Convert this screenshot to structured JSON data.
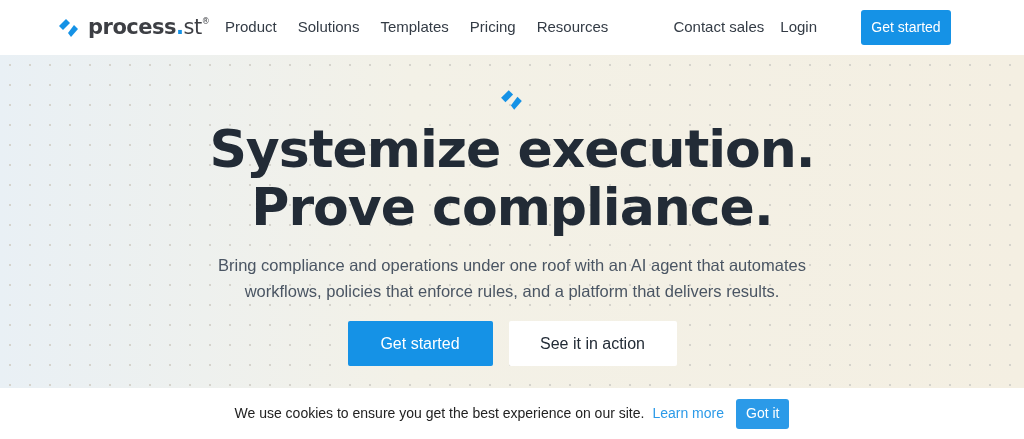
{
  "logo": {
    "name": "process",
    "dot": ".",
    "suffix": "st",
    "registered": "®"
  },
  "nav": {
    "links": [
      "Product",
      "Solutions",
      "Templates",
      "Pricing",
      "Resources"
    ],
    "right_links": [
      "Contact sales",
      "Login"
    ],
    "cta": "Get started"
  },
  "hero": {
    "headline": [
      "Systemize execution.",
      "Prove compliance."
    ],
    "subtext": "Bring compliance and operations under one roof with an AI agent that automates workflows, policies that enforce rules, and a platform that delivers results.",
    "primary_button": "Get started",
    "secondary_button": "See it in action"
  },
  "cookie_bar": {
    "message": "We use cookies to ensure you get the best experience on our site.",
    "link": "Learn more",
    "button": "Got it"
  }
}
